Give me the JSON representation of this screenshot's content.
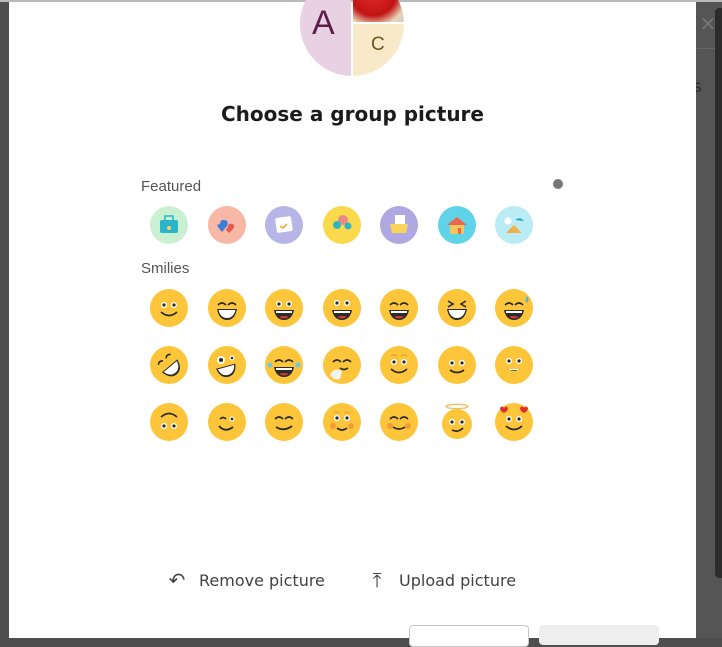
{
  "dialog": {
    "title": "Choose a group picture",
    "avatar": {
      "letters": [
        "A",
        "C"
      ],
      "colors": {
        "a_bg": "#e8d1e2",
        "a_fg": "#5c1e4b",
        "c_bg": "#f8e9c8",
        "c_fg": "#6d5520"
      }
    },
    "sections": {
      "featured": {
        "label": "Featured",
        "items": [
          {
            "name": "briefcase",
            "bg": "#c9f0d0",
            "fg": "#2cb5c9"
          },
          {
            "name": "hearts",
            "bg": "#f7b8a6",
            "fg": "#3a7fd9"
          },
          {
            "name": "calendar",
            "bg": "#b7b4e6",
            "fg": "#f4a634"
          },
          {
            "name": "balloons",
            "bg": "#fbd94c",
            "fg": "#e98a83"
          },
          {
            "name": "folder",
            "bg": "#b0a8e2",
            "fg": "#f9d55a"
          },
          {
            "name": "house",
            "bg": "#5fd3e8",
            "fg": "#e9674d"
          },
          {
            "name": "beach",
            "bg": "#b9ecf4",
            "fg": "#f0b14a"
          }
        ]
      },
      "smilies": {
        "label": "Smilies",
        "items": [
          "smile",
          "beaming-grin",
          "grin",
          "big-grin",
          "laughing",
          "squinting-laugh",
          "sweat-laugh",
          "rolling-laugh",
          "crazy",
          "tears-of-joy",
          "giggle",
          "raised-eyebrow-smile",
          "slight-smile",
          "small-smile",
          "upside-down",
          "wink",
          "relieved",
          "blushing-eyes",
          "blushing-closed",
          "angel",
          "in-love"
        ]
      }
    },
    "actions": {
      "remove": {
        "label": "Remove picture",
        "icon": "undo-icon"
      },
      "upload": {
        "label": "Upload picture",
        "icon": "upload-icon"
      }
    },
    "buttons": {
      "cancel": "",
      "save": ""
    }
  },
  "background": {
    "partial_text": "s",
    "close_icon": "×"
  },
  "colors": {
    "emoji_face": "#fcc53a",
    "emoji_dark": "#2b2b2b",
    "mouth": "#d33b3b",
    "overlay": "#4e4e4e"
  }
}
